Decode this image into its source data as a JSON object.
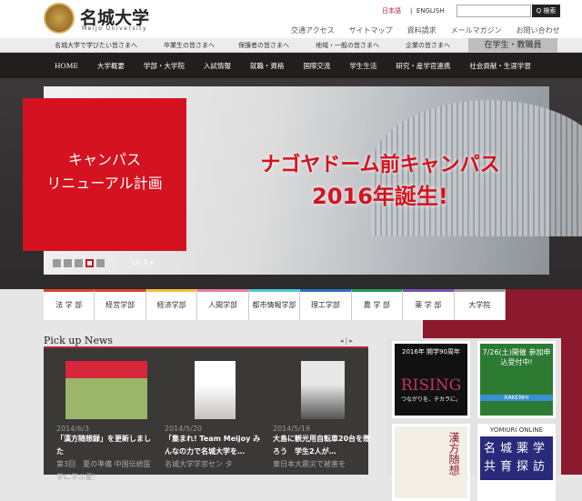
{
  "header": {
    "logo_text": "名城大学",
    "logo_sub": "Meijo University",
    "lang": [
      "日本語",
      "ENGLISH"
    ],
    "search_placeholder": "",
    "search_btn": "Q 検索",
    "util": [
      "交通アクセス",
      "サイトマップ",
      "資料請求",
      "メールマガジン",
      "お問い合わせ"
    ]
  },
  "subnav": [
    "名城大学で学びたい皆さまへ",
    "卒業生の皆さまへ",
    "保護者の皆さまへ",
    "地域・一般の皆さまへ",
    "企業の皆さまへ"
  ],
  "staff": "在学生・教職員",
  "mainnav": [
    "HOME",
    "大学概要",
    "学部・大学院",
    "入試情報",
    "就職・資格",
    "国際交流",
    "学生生活",
    "研究・産学官連携",
    "社会貢献・生涯学習"
  ],
  "hero": {
    "box": "キャンパス\nリニューアル計画",
    "more": "click ▸",
    "headline1": "ナゴヤドーム前キャンパス",
    "headline2": "2016年誕生!",
    "slides": 5,
    "active_slide": 4
  },
  "faculties": [
    {
      "label": "法 学 部",
      "color": "#d9452b"
    },
    {
      "label": "経営学部",
      "color": "#d9452b"
    },
    {
      "label": "経済学部",
      "color": "#f2c230"
    },
    {
      "label": "人間学部",
      "color": "#e87aa0"
    },
    {
      "label": "都市情報学部",
      "color": "#4fc6d4"
    },
    {
      "label": "理工学部",
      "color": "#2a6fc0"
    },
    {
      "label": "農 学 部",
      "color": "#2a9a5a"
    },
    {
      "label": "薬 学 部",
      "color": "#7a4fb0"
    },
    {
      "label": "大学院",
      "color": "#999999"
    }
  ],
  "news": {
    "title": "Pick up News",
    "pager": "◂ | ▸",
    "items": [
      {
        "date": "2014/6/3",
        "title": "「漢方随想録」を更新しました",
        "desc": "第3回　夏の準備 中国伝統医学に学ぶ夏!"
      },
      {
        "date": "2014/5/20",
        "title": "「集まれ! Team Meijoy みんなの力で名城大学を…",
        "desc": "名城大学学窓セン タ"
      },
      {
        "date": "2014/5/19",
        "title": "大島に観光用自転車20台を贈ろう　学生2人が…",
        "desc": "東日本大震災で被害を"
      }
    ]
  },
  "banners": [
    {
      "title": "2016年 開学90周年",
      "big": "RISING",
      "sub": "つながりを、チカラに。"
    },
    {
      "title": "7/26(土)開催 参加申込受付中!",
      "sub": "KAKENHI"
    },
    {
      "title": "漢方随想"
    },
    {
      "title": "YOMIURI ONLINE",
      "chars": "名城薬学共育探訪"
    }
  ]
}
